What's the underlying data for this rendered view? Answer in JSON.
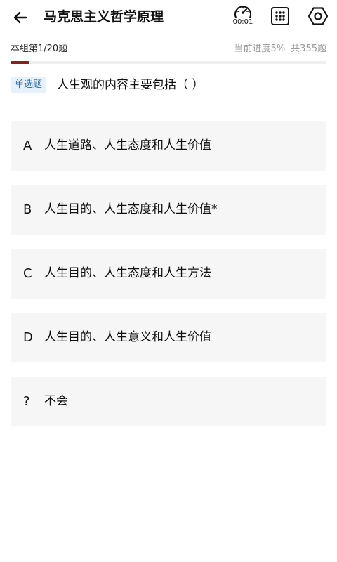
{
  "header": {
    "title": "马克思主义哲学原理",
    "timer": "00:01"
  },
  "progress": {
    "group_label": "本组第1/20题",
    "current_label": "当前进度5%",
    "total_label": "共355题",
    "fill_fraction": 0.06
  },
  "question": {
    "type_label": "单选题",
    "text": "人生观的内容主要包括（  ）"
  },
  "options": [
    {
      "letter": "A",
      "text": "人生道路、人生态度和人生价值"
    },
    {
      "letter": "B",
      "text": "人生目的、人生态度和人生价值*"
    },
    {
      "letter": "C",
      "text": "人生目的、人生态度和人生方法"
    },
    {
      "letter": "D",
      "text": "人生目的、人生意义和人生价值"
    },
    {
      "letter": "?",
      "text": "不会"
    }
  ],
  "colors": {
    "accent": "#8b1e1e",
    "tag_bg": "#e6f1fb",
    "tag_text": "#2f6fa8",
    "option_bg": "#f6f6f6"
  },
  "icons": {
    "back": "arrow-left-icon",
    "timer": "stopwatch-icon",
    "grid": "grid-icon",
    "settings": "hexagon-settings-icon"
  }
}
